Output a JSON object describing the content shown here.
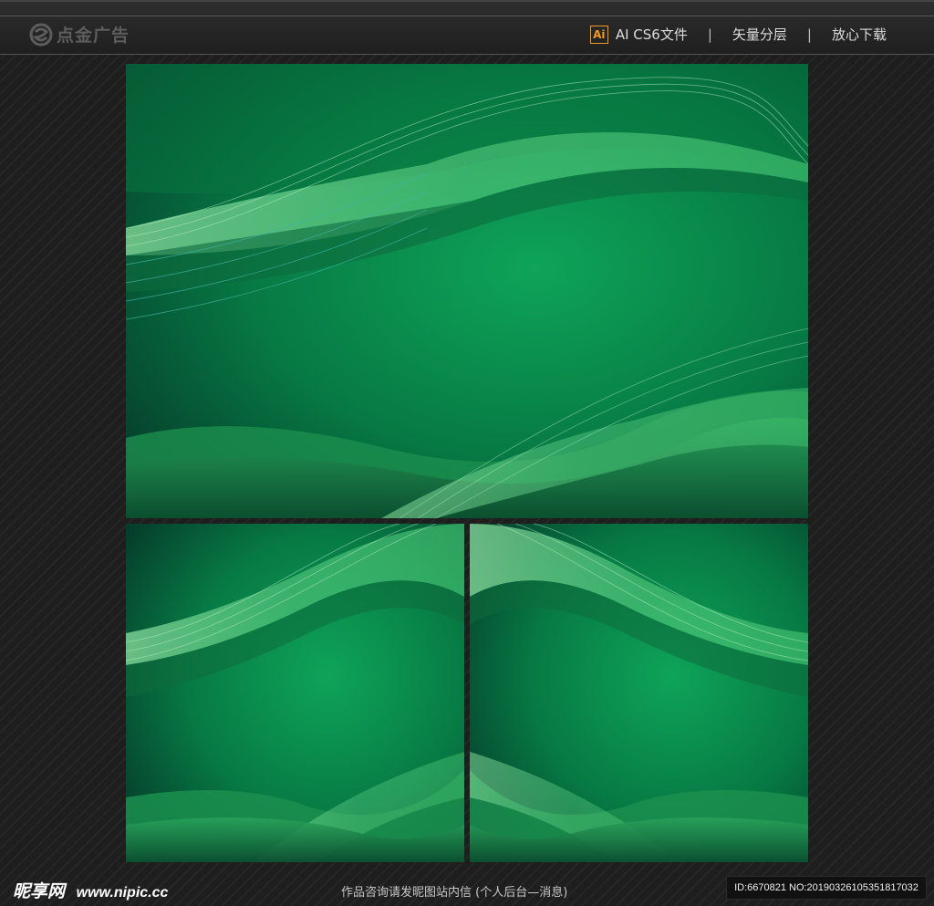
{
  "header": {
    "logo_text": "点金广告",
    "format_badge": "Ai",
    "format_label": "AI CS6文件",
    "separator": "|",
    "layers_label": "矢量分层",
    "download_label": "放心下载"
  },
  "footer": {
    "brand_name": "昵享网",
    "brand_url": "www.nipic.cc",
    "note": "作品咨询请发昵图站内信 (个人后台—消息)",
    "id_text": "ID:6670821 NO:20190326105351817032"
  },
  "colors": {
    "background": "#1e1e1e",
    "wave_light": "#7ddc95",
    "green_mid": "#0b9a52",
    "green_dark": "#053a2a",
    "badge_orange": "#f29a1f"
  }
}
